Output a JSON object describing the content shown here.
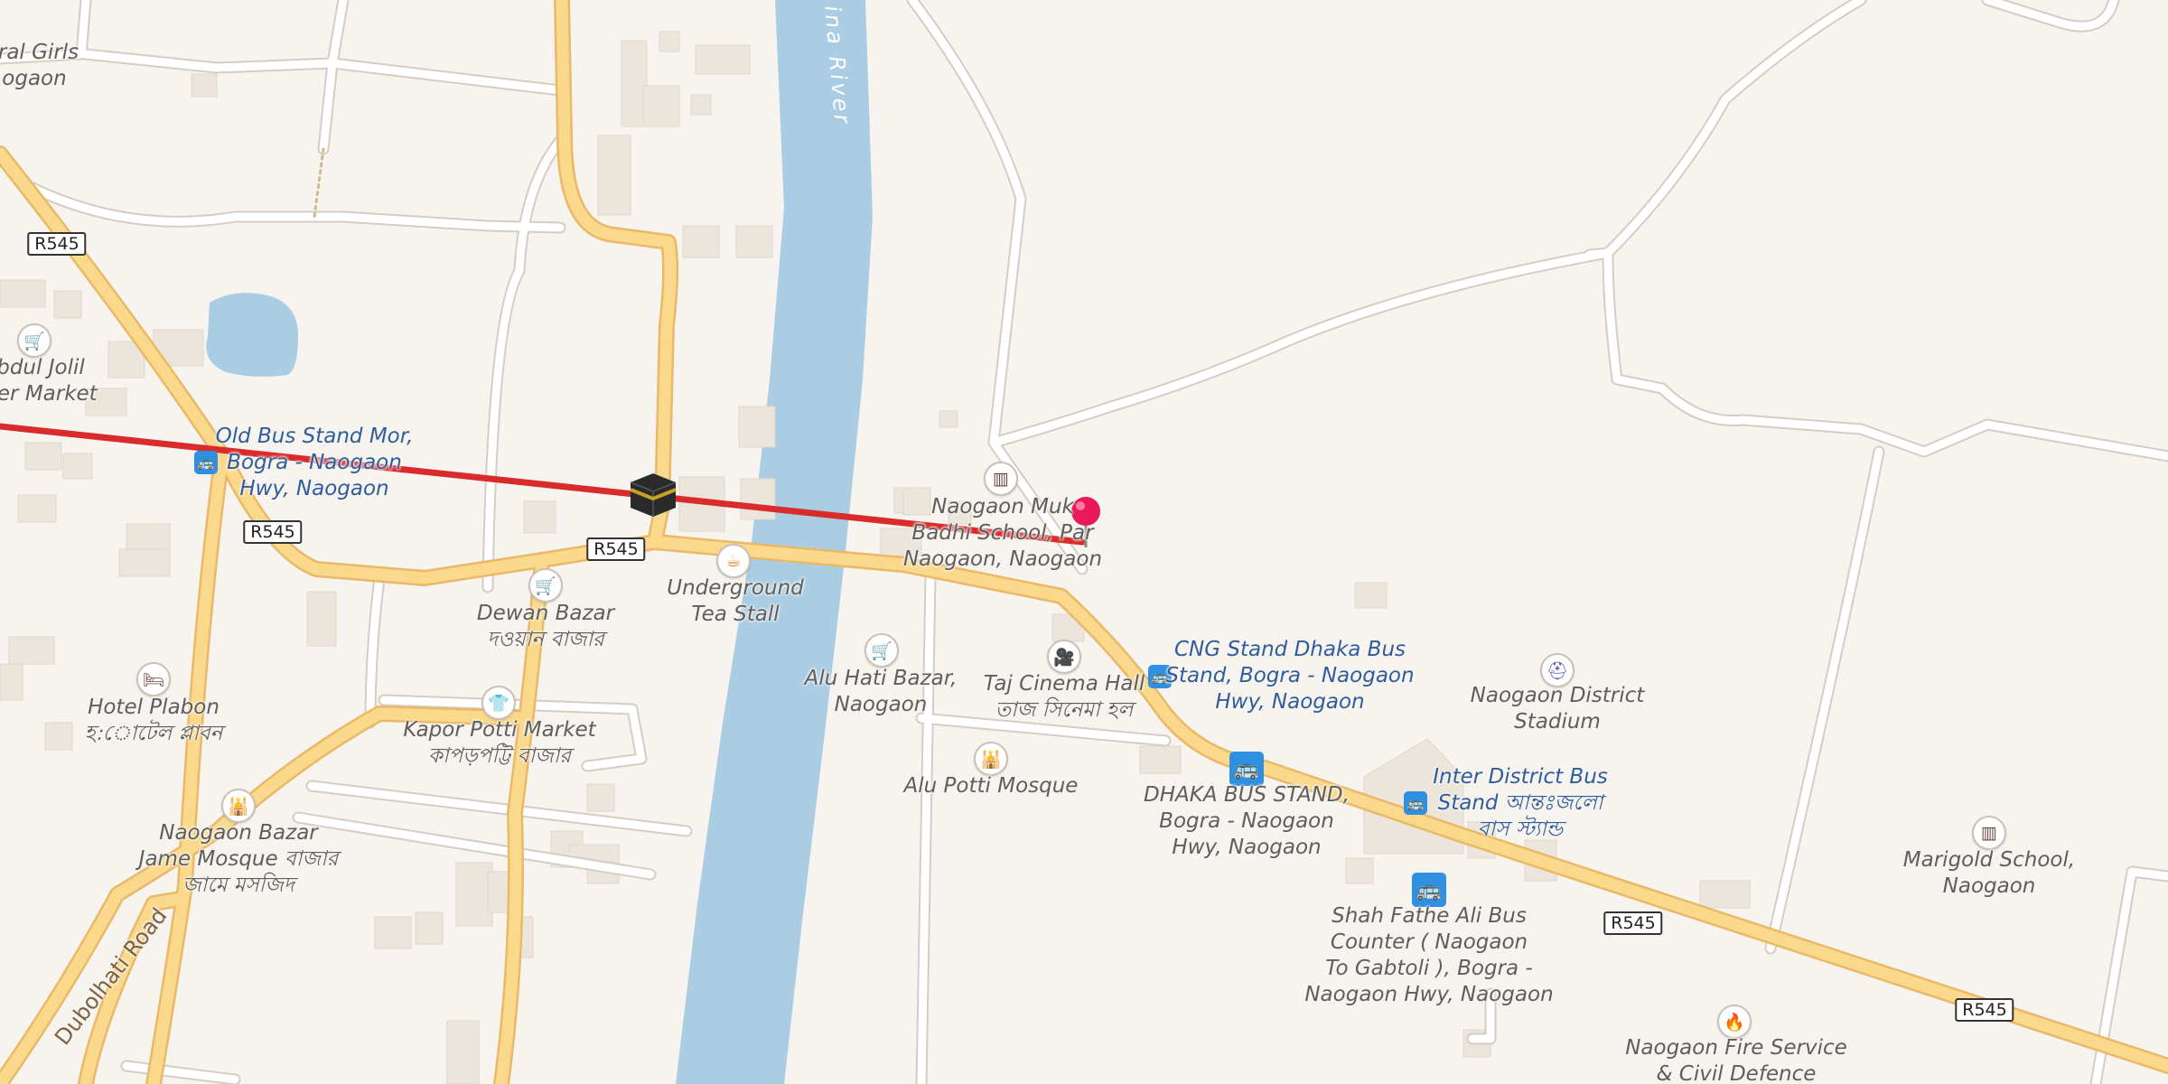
{
  "colors": {
    "land": "#f7f4f0",
    "river": "#aacde3",
    "pond": "#aacde3",
    "major_road": "#fad98c",
    "major_road_casing": "#e9b968",
    "minor_road": "#ffffff",
    "minor_road_casing": "#d9d1c7",
    "building": "#ece5dc",
    "route_line": "#d92b2b",
    "pin": "#e8185a",
    "bus_stop": "#2f8fe0"
  },
  "route_shields": [
    "R545",
    "R545",
    "R545",
    "R545",
    "R545"
  ],
  "water_labels": {
    "river": "ina River"
  },
  "road_labels": {
    "dubolhati": "Dubolhati Road"
  },
  "places": {
    "girls_school": "tral Girls\nogaon",
    "abdul_jolil": "bdul Jolil\nper Market",
    "old_bus_stand": "Old Bus Stand Mor,\nBogra - Naogaon\nHwy, Naogaon",
    "dewan_bazar": "Dewan Bazar\nদওয়ান বাজার",
    "underground_tea": "Underground\nTea Stall",
    "hotel_plabon": "Hotel Plabon\nহ:োটেল প্লাবন",
    "kapor_potti": "Kapor Potti Market\nকাপড়পট্টি বাজার",
    "jame_mosque": "Naogaon Bazar\nJame Mosque বাজার\nজামে মসজিদ",
    "naogaon_school": "Naogaon Muk\nBadhi School, Par\nNaogaon, Naogaon",
    "alu_hati": "Alu Hati Bazar,\nNaogaon",
    "taj_cinema": "Taj Cinema Hall\nতাজ সিনেমা হল",
    "cng_stand": "CNG Stand Dhaka Bus\nStand, Bogra - Naogaon\nHwy, Naogaon",
    "alu_potti_mosque": "Alu Potti Mosque",
    "dhaka_bus_stand": "DHAKA BUS STAND,\nBogra - Naogaon\nHwy, Naogaon",
    "district_stadium": "Naogaon District\nStadium",
    "inter_district": "Inter District Bus\nStand আন্তঃজলো\nবাস স্ট্যান্ড",
    "shah_fathe": "Shah Fathe Ali Bus\nCounter ( Naogaon\nTo Gabtoli ), Bogra -\nNaogaon Hwy, Naogaon",
    "marigold": "Marigold School,\nNaogaon",
    "fire_service": "Naogaon Fire Service\n& Civil Defence"
  },
  "icons": {
    "cart": "🛒",
    "coffee": "☕",
    "bed": "🛏",
    "shirt": "👕",
    "mosque": "🕌",
    "school": "▥",
    "cinema": "🎥",
    "stadium": "⛑",
    "fire": "🔥",
    "bus": "🚌"
  }
}
